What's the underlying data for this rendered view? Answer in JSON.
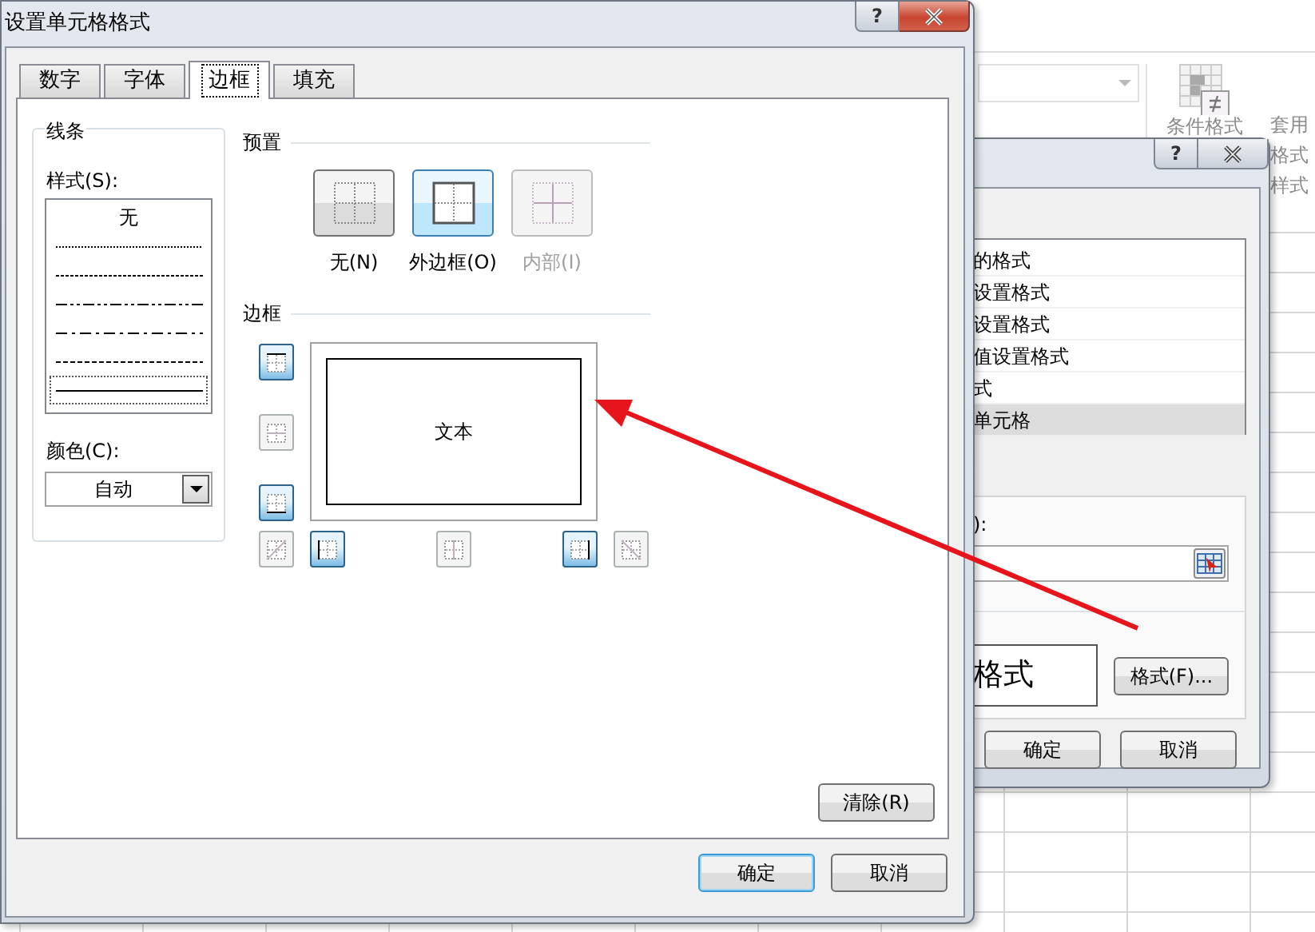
{
  "main_dialog": {
    "title": "设置单元格格式",
    "help_button": "?",
    "tabs": [
      {
        "label": "数字",
        "selected": false
      },
      {
        "label": "字体",
        "selected": false
      },
      {
        "label": "边框",
        "selected": true
      },
      {
        "label": "填充",
        "selected": false
      }
    ],
    "line_group": {
      "title": "线条",
      "style_label": "样式(S):",
      "styles": [
        {
          "kind": "none",
          "label": "无",
          "selected": false
        },
        {
          "kind": "hair",
          "selected": false
        },
        {
          "kind": "dotted",
          "selected": false
        },
        {
          "kind": "dashdotdot",
          "selected": false
        },
        {
          "kind": "dashdot",
          "selected": false
        },
        {
          "kind": "dashed",
          "selected": false
        },
        {
          "kind": "thin",
          "selected": true
        }
      ],
      "color_label": "颜色(C):",
      "color_value": "自动"
    },
    "presets": {
      "title": "预置",
      "items": [
        {
          "kind": "none",
          "label": "无(N)",
          "selected": false,
          "disabled": false
        },
        {
          "kind": "outline",
          "label": "外边框(O)",
          "selected": true,
          "disabled": false
        },
        {
          "kind": "inside",
          "label": "内部(I)",
          "selected": false,
          "disabled": true
        }
      ]
    },
    "border": {
      "title": "边框",
      "preview_text": "文本",
      "buttons": [
        {
          "kind": "top",
          "on": true,
          "disabled": false
        },
        {
          "kind": "hmiddle",
          "on": false,
          "disabled": true
        },
        {
          "kind": "bottom",
          "on": true,
          "disabled": false
        },
        {
          "kind": "diagup",
          "on": false,
          "disabled": true
        },
        {
          "kind": "left",
          "on": true,
          "disabled": false
        },
        {
          "kind": "vmiddle",
          "on": false,
          "disabled": true
        },
        {
          "kind": "right",
          "on": true,
          "disabled": false
        },
        {
          "kind": "diagdown",
          "on": false,
          "disabled": true
        }
      ]
    },
    "clear_button": "清除(R)",
    "buttons": [
      {
        "label": "确定",
        "default": true
      },
      {
        "label": "取消",
        "default": false
      }
    ]
  },
  "back_dialog": {
    "help_button": "?",
    "rules": [
      {
        "label": "的格式",
        "selected": false
      },
      {
        "label": "设置格式",
        "selected": false
      },
      {
        "label": "设置格式",
        "selected": false
      },
      {
        "label": "值设置格式",
        "selected": false
      },
      {
        "label": "式",
        "selected": false
      },
      {
        "label": "单元格",
        "selected": true
      }
    ],
    "field_label": "):",
    "preview_text": "格式",
    "format_button": "格式(F)...",
    "buttons": [
      "确定",
      "取消"
    ]
  },
  "ribbon": {
    "conditional_format": "条件格式",
    "table_format": [
      "套用",
      "格式",
      "样式"
    ]
  }
}
